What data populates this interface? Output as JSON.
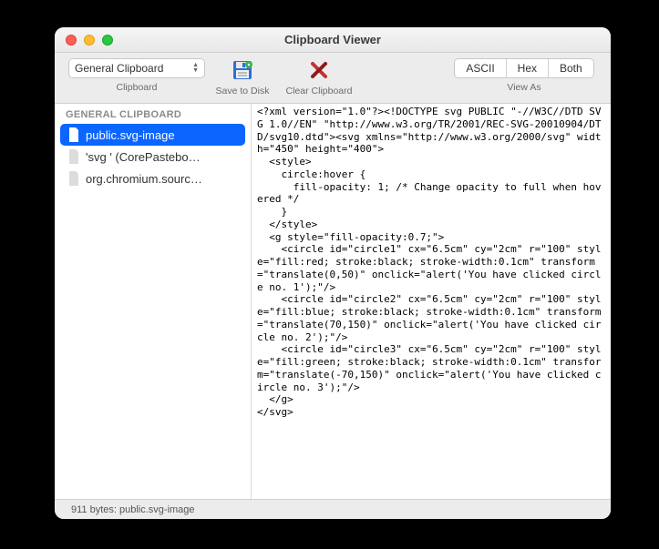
{
  "window": {
    "title": "Clipboard Viewer"
  },
  "toolbar": {
    "clipboard_selector": {
      "selected": "General Clipboard",
      "label": "Clipboard"
    },
    "save": {
      "label": "Save to Disk"
    },
    "clear": {
      "label": "Clear Clipboard"
    },
    "viewas": {
      "label": "View As",
      "options": {
        "ascii": "ASCII",
        "hex": "Hex",
        "both": "Both"
      }
    }
  },
  "sidebar": {
    "header": "GENERAL CLIPBOARD",
    "items": [
      {
        "label": "public.svg-image",
        "selected": true
      },
      {
        "label": "'svg ' (CorePastebo…",
        "selected": false
      },
      {
        "label": "org.chromium.sourc…",
        "selected": false
      }
    ]
  },
  "content": {
    "text": "<?xml version=\"1.0\"?><!DOCTYPE svg PUBLIC \"-//W3C//DTD SVG 1.0//EN\" \"http://www.w3.org/TR/2001/REC-SVG-20010904/DTD/svg10.dtd\"><svg xmlns=\"http://www.w3.org/2000/svg\" width=\"450\" height=\"400\">\n  <style>\n    circle:hover {\n      fill-opacity: 1; /* Change opacity to full when hovered */\n    }\n  </style>\n  <g style=\"fill-opacity:0.7;\">\n    <circle id=\"circle1\" cx=\"6.5cm\" cy=\"2cm\" r=\"100\" style=\"fill:red; stroke:black; stroke-width:0.1cm\" transform=\"translate(0,50)\" onclick=\"alert('You have clicked circle no. 1');\"/>\n    <circle id=\"circle2\" cx=\"6.5cm\" cy=\"2cm\" r=\"100\" style=\"fill:blue; stroke:black; stroke-width:0.1cm\" transform=\"translate(70,150)\" onclick=\"alert('You have clicked circle no. 2');\"/>\n    <circle id=\"circle3\" cx=\"6.5cm\" cy=\"2cm\" r=\"100\" style=\"fill:green; stroke:black; stroke-width:0.1cm\" transform=\"translate(-70,150)\" onclick=\"alert('You have clicked circle no. 3');\"/>\n  </g>\n</svg>"
  },
  "status": {
    "text": "911 bytes: public.svg-image"
  }
}
